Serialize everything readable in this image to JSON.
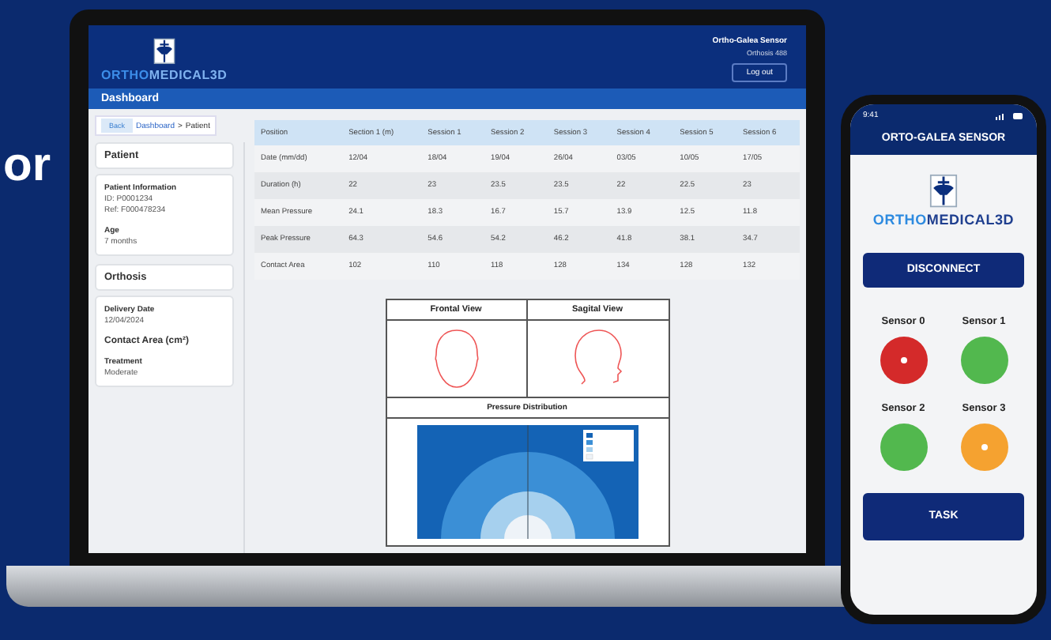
{
  "side_text": "or",
  "laptop": {
    "logo": "**ORTHO**MEDICAL3D",
    "device_name": "Ortho-Galea Sensor",
    "device_sub": "Orthosis 488",
    "logout": "Log out",
    "nav_title": "Dashboard",
    "breadcrumb": {
      "back": "Back",
      "link": "Dashboard",
      "separator": ">",
      "current": "Patient"
    },
    "sidebar": [
      {
        "title": "Patient",
        "fields": [
          {
            "label": "Patient Information",
            "lines": [
              "ID: P0001234",
              "Ref: F000478234"
            ]
          },
          {
            "label": "Age",
            "lines": [
              "7 months"
            ]
          }
        ]
      },
      {
        "title": "Orthosis",
        "fields": [
          {
            "label": "Delivery Date",
            "lines": [
              "12/04/2024"
            ]
          },
          {
            "label": "Contact Area (cm²)",
            "kind": "heading"
          },
          {
            "label": "Treatment",
            "lines": [
              "Moderate"
            ]
          }
        ]
      }
    ],
    "table": {
      "columns": [
        "Position",
        "Section 1 (m)",
        "Session 1",
        "Session 2",
        "Session 3",
        "Session 4",
        "Session 5",
        "Session 6"
      ],
      "rows": [
        [
          "Date (mm/dd)",
          "12/04",
          "18/04",
          "19/04",
          "26/04",
          "03/05",
          "10/05",
          "17/05"
        ],
        [
          "Duration (h)",
          "22",
          "23",
          "23.5",
          "23.5",
          "22",
          "22.5",
          "23"
        ],
        [
          "Mean Pressure",
          "24.1",
          "18.3",
          "16.7",
          "15.7",
          "13.9",
          "12.5",
          "11.8"
        ],
        [
          "Peak Pressure",
          "64.3",
          "54.6",
          "54.2",
          "46.2",
          "41.8",
          "38.1",
          "34.7"
        ],
        [
          "Contact Area",
          "102",
          "110",
          "118",
          "128",
          "134",
          "128",
          "132"
        ]
      ]
    },
    "views": [
      "Frontal View",
      "Sagital View"
    ],
    "distribution_title": "Pressure Distribution"
  },
  "phone": {
    "time": "9:41",
    "title": "ORTO-GALEA SENSOR",
    "logo": "**ORTHO**MEDICAL3D",
    "disconnect": "DISCONNECT",
    "sensors": [
      {
        "name": "Sensor 0",
        "color": "#d42a2a",
        "indicator": true
      },
      {
        "name": "Sensor 1",
        "color": "#52b84e",
        "indicator": false
      },
      {
        "name": "Sensor 2",
        "color": "#52b84e",
        "indicator": false
      },
      {
        "name": "Sensor 3",
        "color": "#f5a230",
        "indicator": true
      }
    ],
    "task": "TASK"
  }
}
